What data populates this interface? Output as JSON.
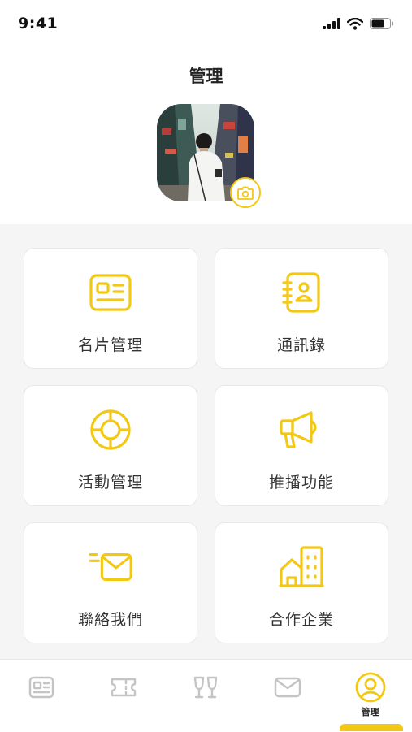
{
  "status_bar": {
    "time": "9:41"
  },
  "header": {
    "title": "管理"
  },
  "menu": [
    {
      "label": "名片管理",
      "icon": "business-card-icon"
    },
    {
      "label": "通訊錄",
      "icon": "address-book-icon"
    },
    {
      "label": "活動管理",
      "icon": "lifebuoy-icon"
    },
    {
      "label": "推播功能",
      "icon": "megaphone-icon"
    },
    {
      "label": "聯絡我們",
      "icon": "mail-fast-icon"
    },
    {
      "label": "合作企業",
      "icon": "building-icon"
    }
  ],
  "tabbar": {
    "items": [
      {
        "icon": "card-icon",
        "label": ""
      },
      {
        "icon": "ticket-icon",
        "label": ""
      },
      {
        "icon": "cheers-icon",
        "label": ""
      },
      {
        "icon": "mail-icon",
        "label": ""
      },
      {
        "icon": "user-circle-icon",
        "label": "管理",
        "active": true
      }
    ]
  },
  "colors": {
    "accent": "#f2c813",
    "inactive_icon": "#c4c4c4",
    "background": "#f5f5f5"
  }
}
